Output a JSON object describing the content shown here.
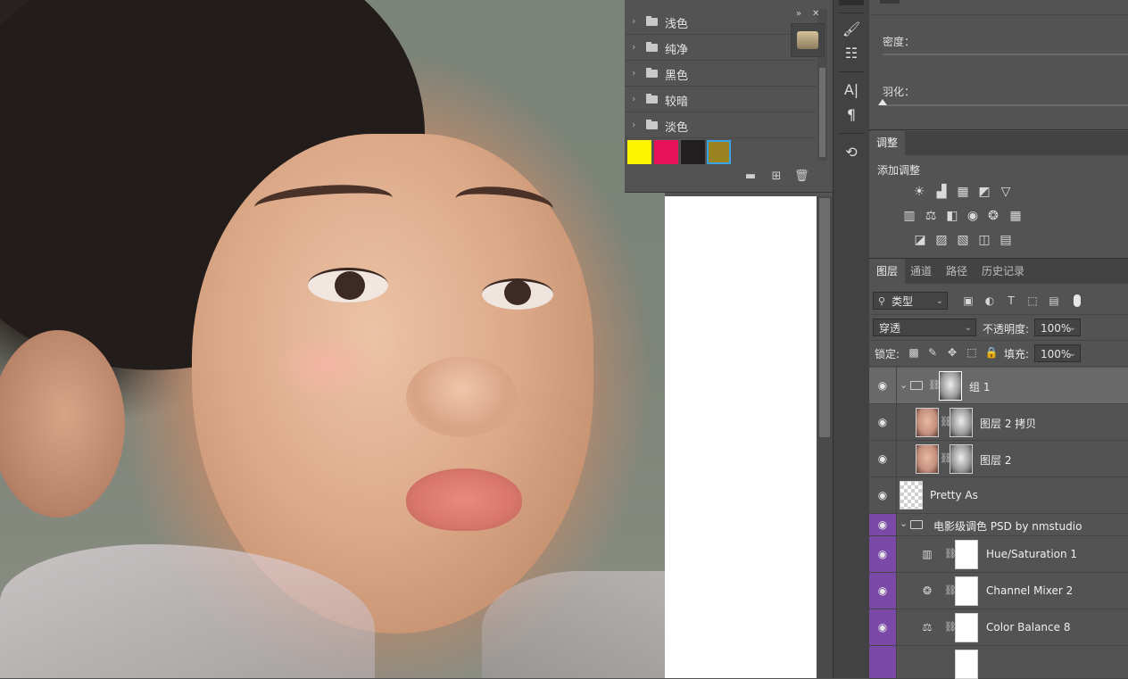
{
  "swatches": {
    "groups": [
      {
        "label": "浅色"
      },
      {
        "label": "纯净"
      },
      {
        "label": "黑色"
      },
      {
        "label": "较暗"
      },
      {
        "label": "淡色"
      }
    ],
    "colors": [
      "#fff400",
      "#e8125a",
      "#231f20",
      "#9b8322"
    ],
    "buttons": {
      "new_group": "folder-icon",
      "new_swatch": "plus-square-icon",
      "delete": "trash-icon"
    },
    "panel_controls": {
      "collapse": "»",
      "close": "✕"
    }
  },
  "tools": [
    "brush-settings-icon",
    "adjustments-icon",
    "character-icon",
    "paragraph-icon",
    "history-brush-icon"
  ],
  "properties": {
    "density_label": "密度：",
    "feather_label": "羽化："
  },
  "adjustments": {
    "tab_label": "调整",
    "add_label": "添加调整",
    "rows": [
      [
        "brightness-icon",
        "levels-icon",
        "curves-icon",
        "exposure-icon",
        "gradient-map-triangle-icon"
      ],
      [
        "hue-saturation-icon",
        "color-balance-icon",
        "black-white-icon",
        "photo-filter-icon",
        "channel-mixer-icon",
        "color-lookup-icon"
      ],
      [
        "invert-icon",
        "posterize-icon",
        "threshold-icon",
        "selective-color-icon",
        "gradient-icon"
      ]
    ]
  },
  "layers_panel": {
    "tabs": [
      "图层",
      "通道",
      "路径",
      "历史记录"
    ],
    "active_tab": "图层",
    "filter_kind": "类型",
    "blend_mode": "穿透",
    "opacity_label": "不透明度:",
    "opacity_value": "100%",
    "lock_label": "锁定:",
    "fill_label": "填充:",
    "fill_value": "100%",
    "layers": [
      {
        "name": "组 1",
        "type": "group",
        "selected": true
      },
      {
        "name": "图层 2 拷贝",
        "type": "pixel-mask"
      },
      {
        "name": "图层 2",
        "type": "pixel-mask"
      },
      {
        "name": "Pretty As",
        "type": "transparent"
      },
      {
        "name": "电影级调色  PSD by nmstudio",
        "type": "group",
        "color": "#7b4aa8"
      },
      {
        "name": "Hue/Saturation 1",
        "type": "adjustment",
        "icon": "hue-saturation-icon"
      },
      {
        "name": "Channel Mixer 2",
        "type": "adjustment",
        "icon": "channel-mixer-icon"
      },
      {
        "name": "Color Balance 8",
        "type": "adjustment",
        "icon": "color-balance-icon"
      }
    ]
  }
}
